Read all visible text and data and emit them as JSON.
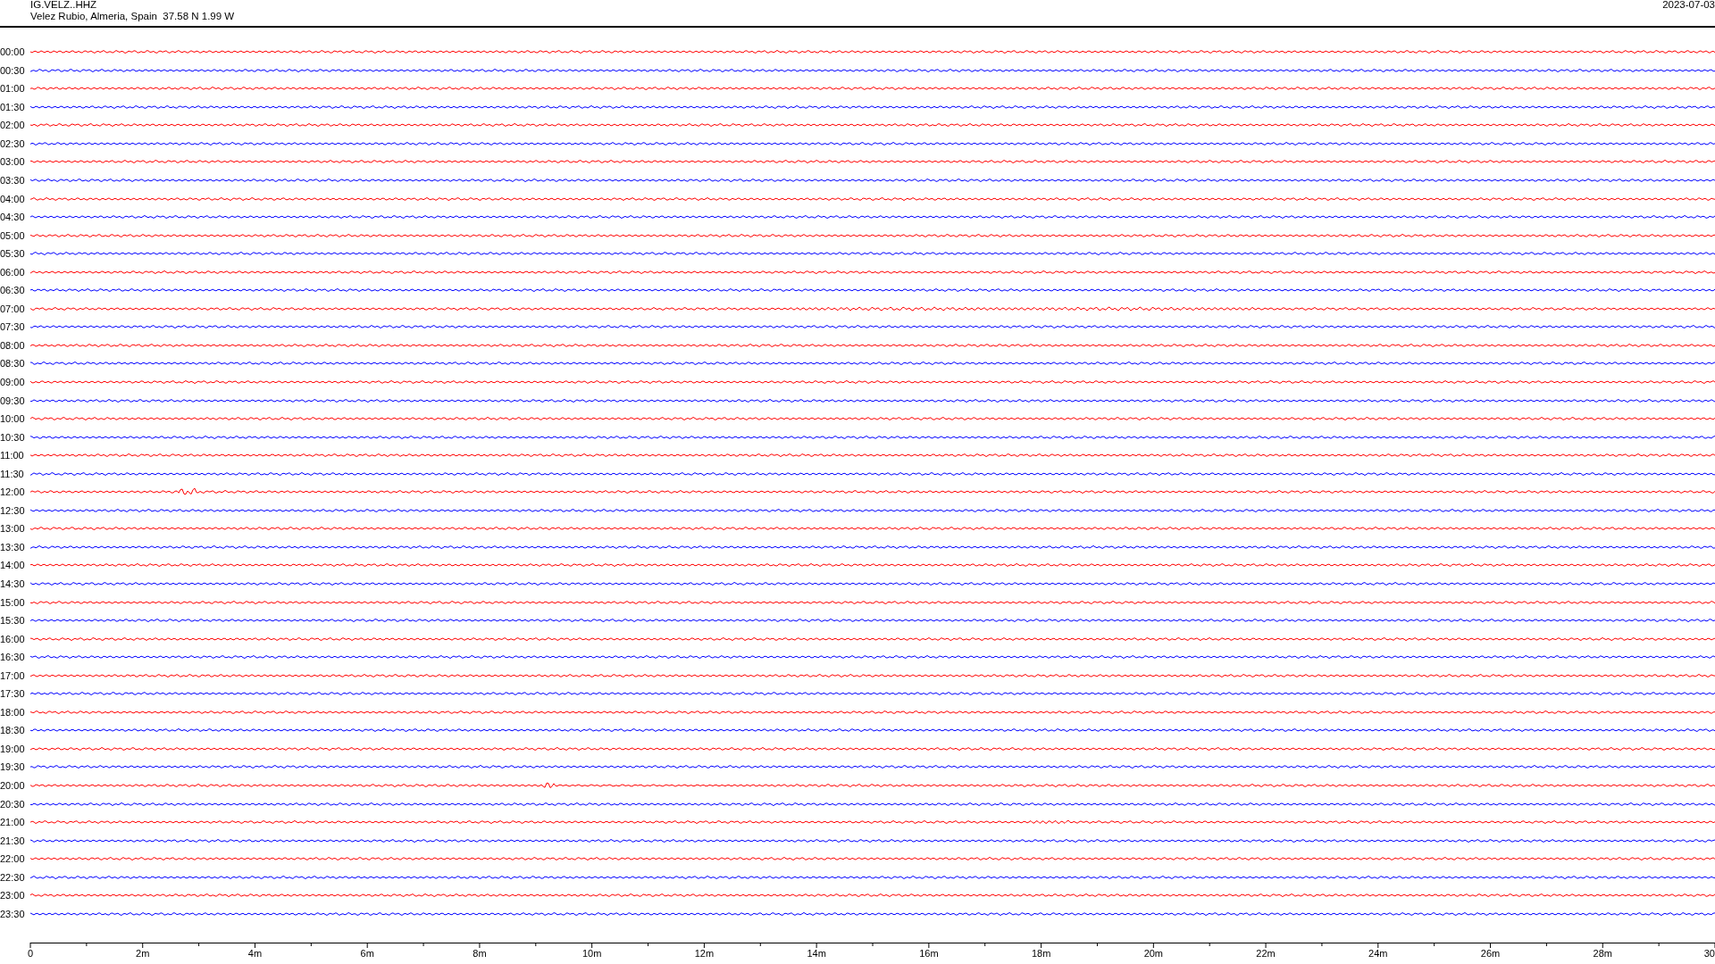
{
  "header": {
    "station": "IG.VELZ..HHZ",
    "location": "Velez Rubio, Almeria, Spain  37.58 N 1.99 W",
    "date": "2023-07-03"
  },
  "rows": [
    {
      "time": "00:00",
      "color": "#ff0000"
    },
    {
      "time": "00:30",
      "color": "#0000ff"
    },
    {
      "time": "01:00",
      "color": "#ff0000"
    },
    {
      "time": "01:30",
      "color": "#0000ff"
    },
    {
      "time": "02:00",
      "color": "#ff0000"
    },
    {
      "time": "02:30",
      "color": "#0000ff"
    },
    {
      "time": "03:00",
      "color": "#ff0000"
    },
    {
      "time": "03:30",
      "color": "#0000ff"
    },
    {
      "time": "04:00",
      "color": "#ff0000"
    },
    {
      "time": "04:30",
      "color": "#0000ff"
    },
    {
      "time": "05:00",
      "color": "#ff0000"
    },
    {
      "time": "05:30",
      "color": "#0000ff"
    },
    {
      "time": "06:00",
      "color": "#ff0000"
    },
    {
      "time": "06:30",
      "color": "#0000ff"
    },
    {
      "time": "07:00",
      "color": "#ff0000"
    },
    {
      "time": "07:30",
      "color": "#0000ff"
    },
    {
      "time": "08:00",
      "color": "#ff0000"
    },
    {
      "time": "08:30",
      "color": "#0000ff"
    },
    {
      "time": "09:00",
      "color": "#ff0000"
    },
    {
      "time": "09:30",
      "color": "#0000ff"
    },
    {
      "time": "10:00",
      "color": "#ff0000"
    },
    {
      "time": "10:30",
      "color": "#0000ff"
    },
    {
      "time": "11:00",
      "color": "#ff0000"
    },
    {
      "time": "11:30",
      "color": "#0000ff"
    },
    {
      "time": "12:00",
      "color": "#ff0000"
    },
    {
      "time": "12:30",
      "color": "#0000ff"
    },
    {
      "time": "13:00",
      "color": "#ff0000"
    },
    {
      "time": "13:30",
      "color": "#0000ff"
    },
    {
      "time": "14:00",
      "color": "#ff0000"
    },
    {
      "time": "14:30",
      "color": "#0000ff"
    },
    {
      "time": "15:00",
      "color": "#ff0000"
    },
    {
      "time": "15:30",
      "color": "#0000ff"
    },
    {
      "time": "16:00",
      "color": "#ff0000"
    },
    {
      "time": "16:30",
      "color": "#0000ff"
    },
    {
      "time": "17:00",
      "color": "#ff0000"
    },
    {
      "time": "17:30",
      "color": "#0000ff"
    },
    {
      "time": "18:00",
      "color": "#ff0000"
    },
    {
      "time": "18:30",
      "color": "#0000ff"
    },
    {
      "time": "19:00",
      "color": "#ff0000"
    },
    {
      "time": "19:30",
      "color": "#0000ff"
    },
    {
      "time": "20:00",
      "color": "#ff0000"
    },
    {
      "time": "20:30",
      "color": "#0000ff"
    },
    {
      "time": "21:00",
      "color": "#ff0000"
    },
    {
      "time": "21:30",
      "color": "#0000ff"
    },
    {
      "time": "22:00",
      "color": "#ff0000"
    },
    {
      "time": "22:30",
      "color": "#0000ff"
    },
    {
      "time": "23:00",
      "color": "#ff0000"
    },
    {
      "time": "23:30",
      "color": "#0000ff"
    }
  ],
  "axis": {
    "labels": [
      "0",
      "2m",
      "4m",
      "6m",
      "8m",
      "10m",
      "12m",
      "14m",
      "16m",
      "18m",
      "20m",
      "22m",
      "24m",
      "26m",
      "28m",
      "30"
    ]
  }
}
